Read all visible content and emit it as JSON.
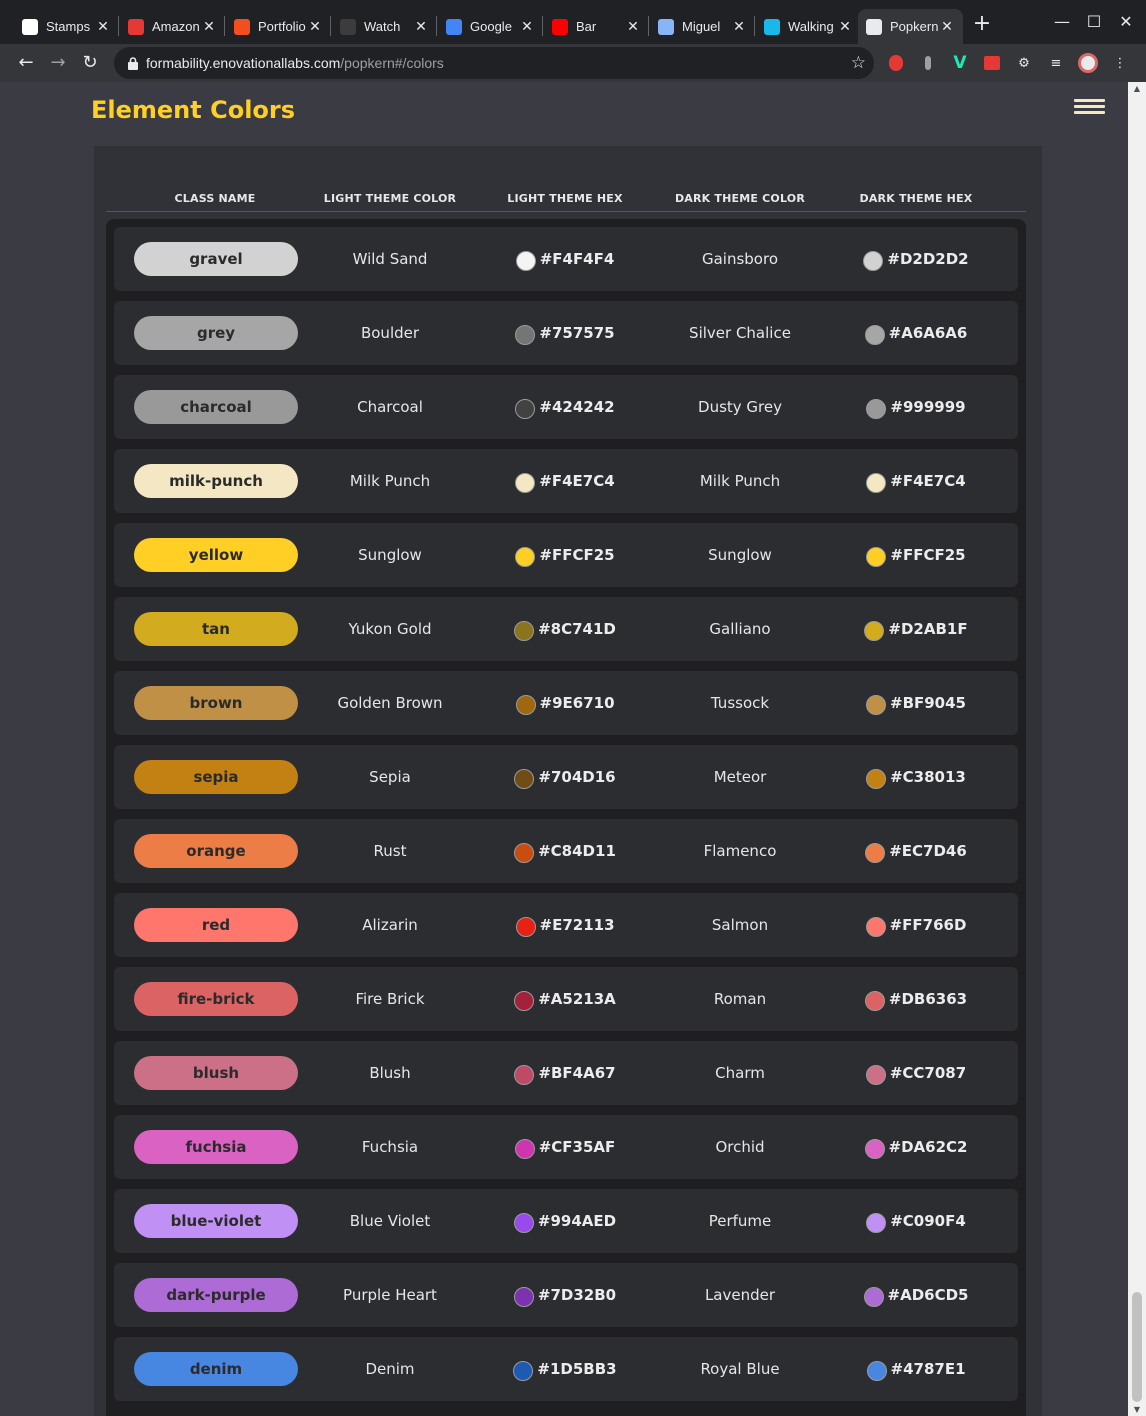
{
  "browser": {
    "tabs": [
      {
        "title": "Stamps",
        "icon": "stamps-favicon",
        "color": "#ffffff"
      },
      {
        "title": "Amazon",
        "icon": "amazon-favicon",
        "color": "#e53935"
      },
      {
        "title": "Portfolio",
        "icon": "figma-favicon",
        "color": "#f24e1e"
      },
      {
        "title": "Watch",
        "icon": "tumblr-favicon",
        "color": "#3c3c3c"
      },
      {
        "title": "Google",
        "icon": "google-calendar-favicon",
        "color": "#4285f4"
      },
      {
        "title": "Bar",
        "icon": "youtube-favicon",
        "color": "#ff0000"
      },
      {
        "title": "Miguel",
        "icon": "profile-favicon",
        "color": "#8ab4f8"
      },
      {
        "title": "Walking",
        "icon": "vimeo-favicon",
        "color": "#1ab7ea"
      },
      {
        "title": "Popkern",
        "icon": "k-favicon",
        "color": "#e8eaed"
      }
    ],
    "url_host": "formability.enovationallabs.com",
    "url_path": "/popkern#/colors"
  },
  "page": {
    "title": "Element Colors",
    "accent": "#ffcf25"
  },
  "table": {
    "headers": [
      "CLASS NAME",
      "LIGHT THEME COLOR",
      "LIGHT THEME HEX",
      "DARK THEME COLOR",
      "DARK THEME HEX"
    ],
    "rows": [
      {
        "class": "gravel",
        "light_name": "Wild Sand",
        "light_hex": "#F4F4F4",
        "dark_name": "Gainsboro",
        "dark_hex": "#D2D2D2"
      },
      {
        "class": "grey",
        "light_name": "Boulder",
        "light_hex": "#757575",
        "dark_name": "Silver Chalice",
        "dark_hex": "#A6A6A6"
      },
      {
        "class": "charcoal",
        "light_name": "Charcoal",
        "light_hex": "#424242",
        "dark_name": "Dusty Grey",
        "dark_hex": "#999999"
      },
      {
        "class": "milk-punch",
        "light_name": "Milk Punch",
        "light_hex": "#F4E7C4",
        "dark_name": "Milk Punch",
        "dark_hex": "#F4E7C4"
      },
      {
        "class": "yellow",
        "light_name": "Sunglow",
        "light_hex": "#FFCF25",
        "dark_name": "Sunglow",
        "dark_hex": "#FFCF25"
      },
      {
        "class": "tan",
        "light_name": "Yukon Gold",
        "light_hex": "#8C741D",
        "dark_name": "Galliano",
        "dark_hex": "#D2AB1F"
      },
      {
        "class": "brown",
        "light_name": "Golden Brown",
        "light_hex": "#9E6710",
        "dark_name": "Tussock",
        "dark_hex": "#BF9045"
      },
      {
        "class": "sepia",
        "light_name": "Sepia",
        "light_hex": "#704D16",
        "dark_name": "Meteor",
        "dark_hex": "#C38013"
      },
      {
        "class": "orange",
        "light_name": "Rust",
        "light_hex": "#C84D11",
        "dark_name": "Flamenco",
        "dark_hex": "#EC7D46"
      },
      {
        "class": "red",
        "light_name": "Alizarin",
        "light_hex": "#E72113",
        "dark_name": "Salmon",
        "dark_hex": "#FF766D"
      },
      {
        "class": "fire-brick",
        "light_name": "Fire Brick",
        "light_hex": "#A5213A",
        "dark_name": "Roman",
        "dark_hex": "#DB6363"
      },
      {
        "class": "blush",
        "light_name": "Blush",
        "light_hex": "#BF4A67",
        "dark_name": "Charm",
        "dark_hex": "#CC7087"
      },
      {
        "class": "fuchsia",
        "light_name": "Fuchsia",
        "light_hex": "#CF35AF",
        "dark_name": "Orchid",
        "dark_hex": "#DA62C2"
      },
      {
        "class": "blue-violet",
        "light_name": "Blue Violet",
        "light_hex": "#994AED",
        "dark_name": "Perfume",
        "dark_hex": "#C090F4"
      },
      {
        "class": "dark-purple",
        "light_name": "Purple Heart",
        "light_hex": "#7D32B0",
        "dark_name": "Lavender",
        "dark_hex": "#AD6CD5"
      },
      {
        "class": "denim",
        "light_name": "Denim",
        "light_hex": "#1D5BB3",
        "dark_name": "Royal Blue",
        "dark_hex": "#4787E1"
      }
    ]
  }
}
